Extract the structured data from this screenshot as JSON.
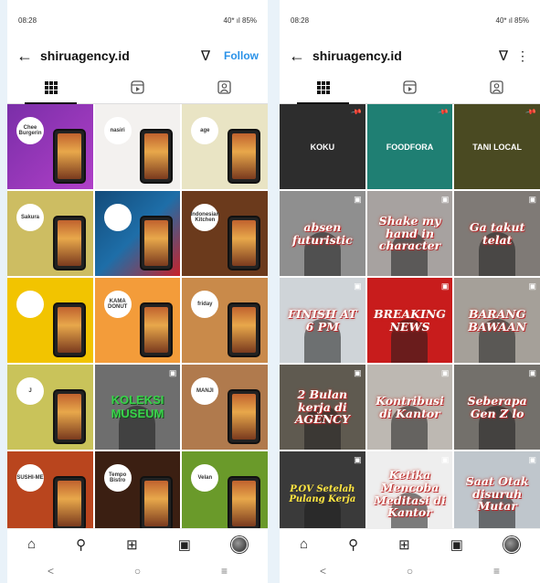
{
  "left": {
    "status": {
      "time": "08:28",
      "right": "40* ıl 85%"
    },
    "handle": "shiruagency.id",
    "follow": "Follow",
    "tiles": [
      {
        "bg": "linear-gradient(135deg,#7a2ea8,#b040c8)",
        "logo": "Chee Burgerin"
      },
      {
        "bg": "#f3f1ef",
        "logo": "nasiri"
      },
      {
        "bg": "#e9e4c4",
        "logo": "age"
      },
      {
        "bg": "#cdbd62",
        "logo": "Sakura"
      },
      {
        "bg": "linear-gradient(135deg,#134b7a,#1e6ea8 50%,#c8222a)",
        "logo": ""
      },
      {
        "bg": "#6b3a1c",
        "logo": "Indonesian Kitchen"
      },
      {
        "bg": "#f2c400",
        "logo": ""
      },
      {
        "bg": "#f39c3a",
        "logo": "KAMA DONUT"
      },
      {
        "bg": "#c98a4a",
        "logo": "friday"
      },
      {
        "bg": "#c9c35a",
        "logo": "J"
      },
      {
        "bg": "#6e6e6e",
        "caption": "KOLEKSI MUSEUM"
      },
      {
        "bg": "#b07a4d",
        "logo": "MANJI"
      },
      {
        "bg": "#b9451e",
        "logo": "SUSHI-ME"
      },
      {
        "bg": "#3b1f12",
        "logo": "Tempo Bistro"
      },
      {
        "bg": "#6a9a2a",
        "logo": "Velan"
      }
    ]
  },
  "right": {
    "status": {
      "time": "08:28",
      "right": "40* ıl 85%"
    },
    "handle": "shiruagency.id",
    "tiles": [
      {
        "bg": "#2d2d2d",
        "label": "KOKU",
        "pin": true
      },
      {
        "bg": "#1f7f73",
        "label": "FOODFORA",
        "pin": true
      },
      {
        "bg": "#4a4a22",
        "label": "TANI LOCAL",
        "pin": true
      },
      {
        "bg": "#8f8f8f",
        "caption": "absen futuristic"
      },
      {
        "bg": "#a7a2a0",
        "caption": "Shake my hand in character"
      },
      {
        "bg": "#7f7a76",
        "caption": "Ga takut telat"
      },
      {
        "bg": "#cfd4d8",
        "caption": "FINISH AT 6 PM"
      },
      {
        "bg": "#c81c1c",
        "caption": "BREAKING NEWS"
      },
      {
        "bg": "#a5a099",
        "caption": "BARANG BAWAAN"
      },
      {
        "bg": "#5f5a50",
        "caption": "2 Bulan kerja di AGENCY"
      },
      {
        "bg": "#bdb8b2",
        "caption": "Kontribusi di Kantor"
      },
      {
        "bg": "#73706b",
        "caption": "Seberapa Gen Z lo"
      },
      {
        "bg": "#3a3a3a",
        "caption": "P.OV Setelah Pulang Kerja",
        "yellow": true
      },
      {
        "bg": "#eeeeee",
        "caption": "Ketika Mencoba Meditasi di Kantor"
      },
      {
        "bg": "#bfc6cc",
        "caption": "Saat Otak disuruh Mutar"
      }
    ]
  },
  "icons": {
    "back": "←",
    "filter": "∇",
    "more": "⋮",
    "home": "⌂",
    "search": "⚲",
    "add": "⊞",
    "reels": "▣",
    "nav_back": "<",
    "nav_home": "○",
    "nav_menu": "≡"
  }
}
